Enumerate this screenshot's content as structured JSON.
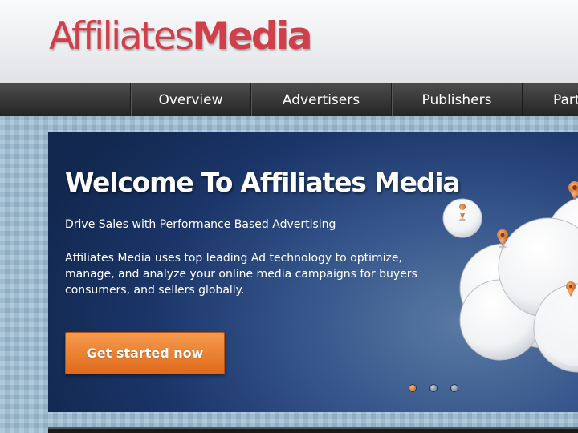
{
  "logo": {
    "part1": "Affiliates",
    "part2": "Media"
  },
  "nav": {
    "items": [
      {
        "label": "Overview"
      },
      {
        "label": "Advertisers"
      },
      {
        "label": "Publishers"
      },
      {
        "label": "Part"
      }
    ]
  },
  "hero": {
    "title": "Welcome To Affiliates Media",
    "subtitle": "Drive Sales with Performance Based Advertising",
    "body": "Affiliates Media uses top leading Ad technology to optimize, manage, and analyze your online media campaigns for buyers consumers, and sellers globally.",
    "cta_label": "Get started now",
    "slides": {
      "count": 3,
      "active": 1
    }
  },
  "colors": {
    "brand_red": "#d0404a",
    "cta_orange": "#ee8434",
    "hero_blue": "#1b3569",
    "nav_dark": "#2f2f2f"
  },
  "icons": [
    "map-pin-icon"
  ]
}
